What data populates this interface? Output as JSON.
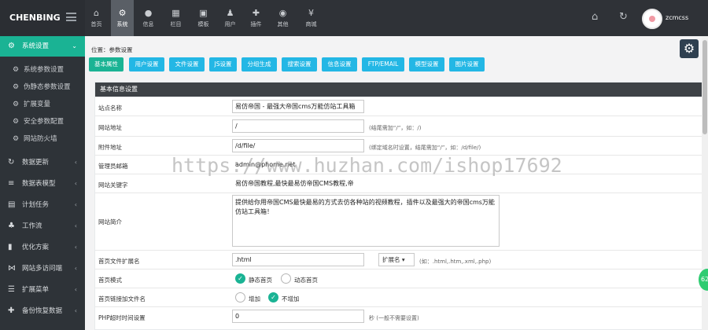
{
  "brand": "CHENBING",
  "topnav": [
    {
      "label": "首页",
      "icon": "home-icon",
      "glyph": "⌂"
    },
    {
      "label": "系统",
      "icon": "gears-icon",
      "glyph": "⚙"
    },
    {
      "label": "信息",
      "icon": "globe-icon",
      "glyph": "●"
    },
    {
      "label": "栏目",
      "icon": "grid-icon",
      "glyph": "▦"
    },
    {
      "label": "模板",
      "icon": "html5-icon",
      "glyph": "▣"
    },
    {
      "label": "用户",
      "icon": "user-icon",
      "glyph": "♟"
    },
    {
      "label": "插件",
      "icon": "puzzle-icon",
      "glyph": "✚"
    },
    {
      "label": "其他",
      "icon": "github-icon",
      "glyph": "◉"
    },
    {
      "label": "商城",
      "icon": "yen-icon",
      "glyph": "¥"
    }
  ],
  "user": {
    "name": "zcmcss"
  },
  "sidebar": {
    "active_section": "系统设置",
    "sub_items": [
      "系统参数设置",
      "伪静态参数设置",
      "扩展变量",
      "安全参数配置",
      "网站防火墙"
    ],
    "sections": [
      "数据更新",
      "数据表模型",
      "计划任务",
      "工作流",
      "优化方案",
      "网站多访问端",
      "扩展菜单",
      "备份恢复数据"
    ]
  },
  "breadcrumb": "位置：参数设置",
  "tabs": [
    "基本属性",
    "用户设置",
    "文件设置",
    "JS设置",
    "分组生成",
    "搜索设置",
    "信息设置",
    "FTP/EMAIL",
    "模型设置",
    "图片设置"
  ],
  "panel_title": "基本信息设置",
  "fields": {
    "site_name": {
      "label": "站点名称",
      "value": "易仿帝国 - 最强大帝国cms万能仿站工具箱"
    },
    "site_url": {
      "label": "网站地址",
      "value": "/",
      "hint": "(结尾需加“/”，如：/)"
    },
    "attach_url": {
      "label": "附件地址",
      "value": "/d/file/",
      "hint": "(绑定域名时设置，结尾需加“/”，如：/d/file/)"
    },
    "admin_email": {
      "label": "管理员邮箱",
      "value": "admin@phome.net"
    },
    "keywords": {
      "label": "网站关键字",
      "value": "易仿帝国教程,最快最易仿帝国CMS教程,帝"
    },
    "description": {
      "label": "网站简介",
      "value": "提供给你用帝国CMS最快最易的方式去仿各种站的视频教程，插件以及最强大的帝国cms万能仿站工具箱！"
    },
    "index_ext": {
      "label": "首页文件扩展名",
      "value": ".html",
      "select": "扩展名",
      "hint": "(如：.html,.htm,.xml,.php)"
    },
    "index_mode": {
      "label": "首页模式",
      "options": [
        "静态首页",
        "动态首页"
      ],
      "selected": "静态首页"
    },
    "index_link": {
      "label": "首页链接加文件名",
      "options": [
        "增加",
        "不增加"
      ],
      "selected": "不增加"
    },
    "php_timeout": {
      "label": "PHP超时时间设置",
      "value": "0",
      "hint": "秒 (一般不需要设置)"
    }
  },
  "watermark": "https://www.huzhan.com/ishop17692",
  "float_badge": "62",
  "colors": {
    "accent": "#1ab394",
    "tab": "#23b7e5",
    "topbar": "#2f3237",
    "sidebar": "#2e3338",
    "panel_head": "#3e4246"
  }
}
